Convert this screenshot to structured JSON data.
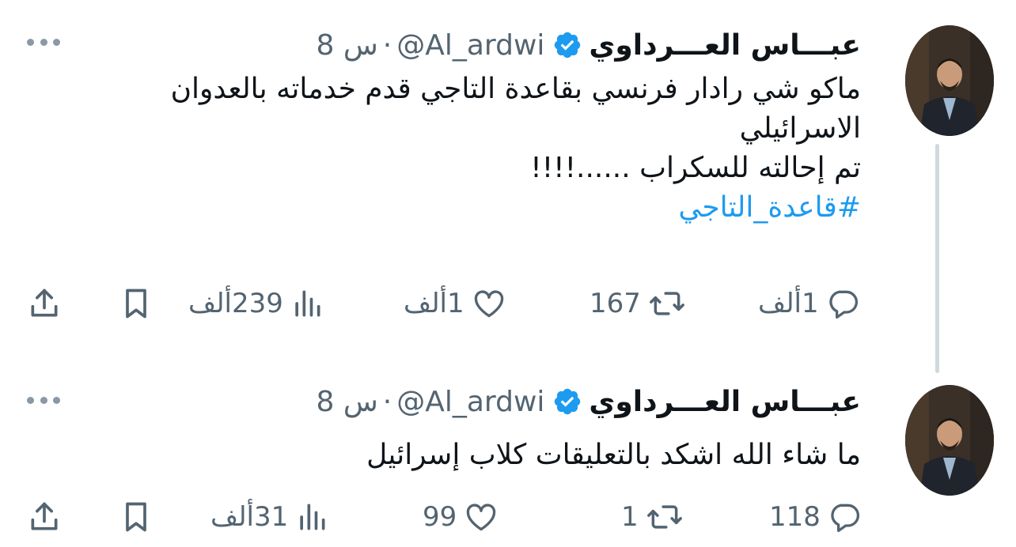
{
  "tweets": [
    {
      "author": {
        "name": "عبـــاس العـــرداوي",
        "handle": "@Al_ardwi",
        "verified": true
      },
      "separator": "·",
      "time": "8 س",
      "text_lines": [
        "ماكو شي رادار فرنسي بقاعدة التاجي قدم خدماته بالعدوان",
        "الاسرائيلي",
        "تم إحالته للسكراب ......!!!!"
      ],
      "hashtag": "#قاعدة_التاجي",
      "actions": {
        "replies": "1ألف",
        "reposts": "167",
        "likes": "1ألف",
        "views": "239ألف"
      }
    },
    {
      "author": {
        "name": "عبـــاس العـــرداوي",
        "handle": "@Al_ardwi",
        "verified": true
      },
      "separator": "·",
      "time": "8 س",
      "text_lines": [
        "ما شاء الله اشكد بالتعليقات كلاب إسرائيل"
      ],
      "actions": {
        "replies": "118",
        "reposts": "1",
        "likes": "99",
        "views": "31ألف"
      }
    }
  ],
  "icons": {
    "reply": "speech-bubble-icon",
    "repost": "repost-arrows-icon",
    "like": "heart-icon",
    "views": "bar-chart-icon",
    "bookmark": "bookmark-icon",
    "share": "share-upload-icon",
    "more": "more-dots-icon",
    "verified": "verified-badge-icon"
  },
  "colors": {
    "verified": "#1d9bf0",
    "hashtag": "#1d9bf0",
    "secondary_text": "#536471",
    "primary_text": "#0f1419",
    "thread_line": "#cfd9de"
  }
}
